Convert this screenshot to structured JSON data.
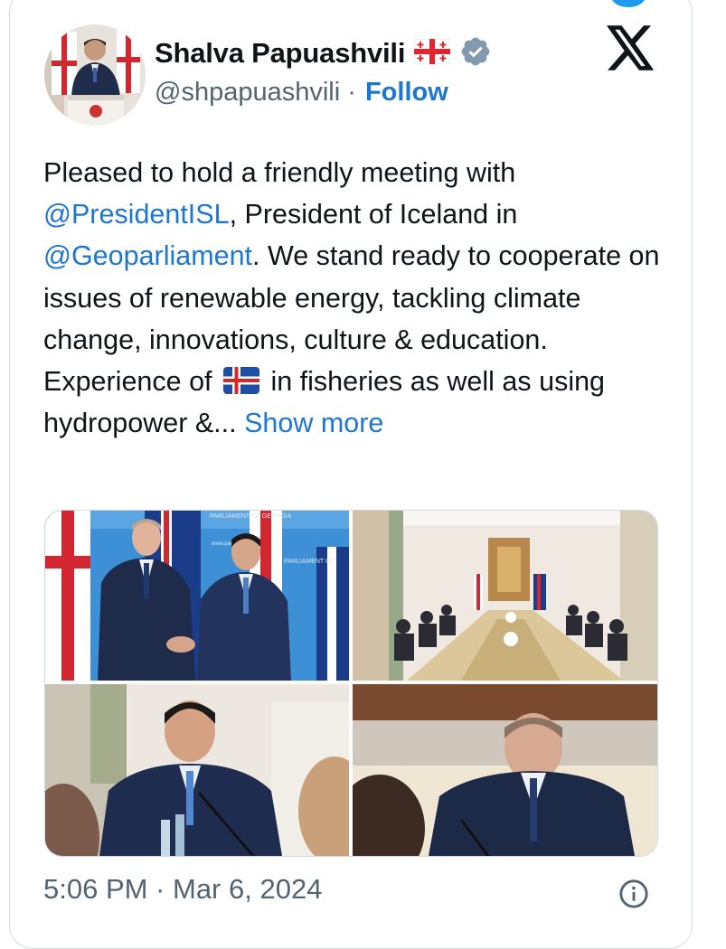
{
  "colors": {
    "accent": "#1d76d0",
    "muted": "#536471",
    "text": "#0f1419",
    "verified": "#829aab"
  },
  "author": {
    "name": "Shalva Papuashvili",
    "name_flag_icon": "georgia-flag-emoji",
    "verified_icon": "verified-badge-icon",
    "handle": "@shpapuashvili",
    "separator": " · ",
    "follow_label": "Follow"
  },
  "platform_icon": "x-logo-icon",
  "tweet": {
    "p1": "Pleased to hold a friendly meeting with ",
    "mention1": "@PresidentISL",
    "p2": ", President of Iceland in ",
    "mention2": "@Geoparliament",
    "p3": ". We stand ready to cooperate on issues of renewable energy, tackling climate change, innovations, culture & education. Experience of ",
    "inline_flag_icon": "iceland-flag-emoji",
    "p4": " in fisheries as well as using hydropower &...",
    "show_more": " Show more"
  },
  "media": {
    "photos": [
      {
        "sign_1": "PARLIAMENT OF GEORGIA",
        "sign_2": "PARLIAMENT OF",
        "sign_3": "www.parliament.ge"
      },
      {
        "desc": ""
      },
      {
        "desc": ""
      },
      {
        "desc": ""
      }
    ]
  },
  "footer": {
    "timestamp": "5:06 PM · Mar 6, 2024",
    "info_icon": "info-icon"
  }
}
